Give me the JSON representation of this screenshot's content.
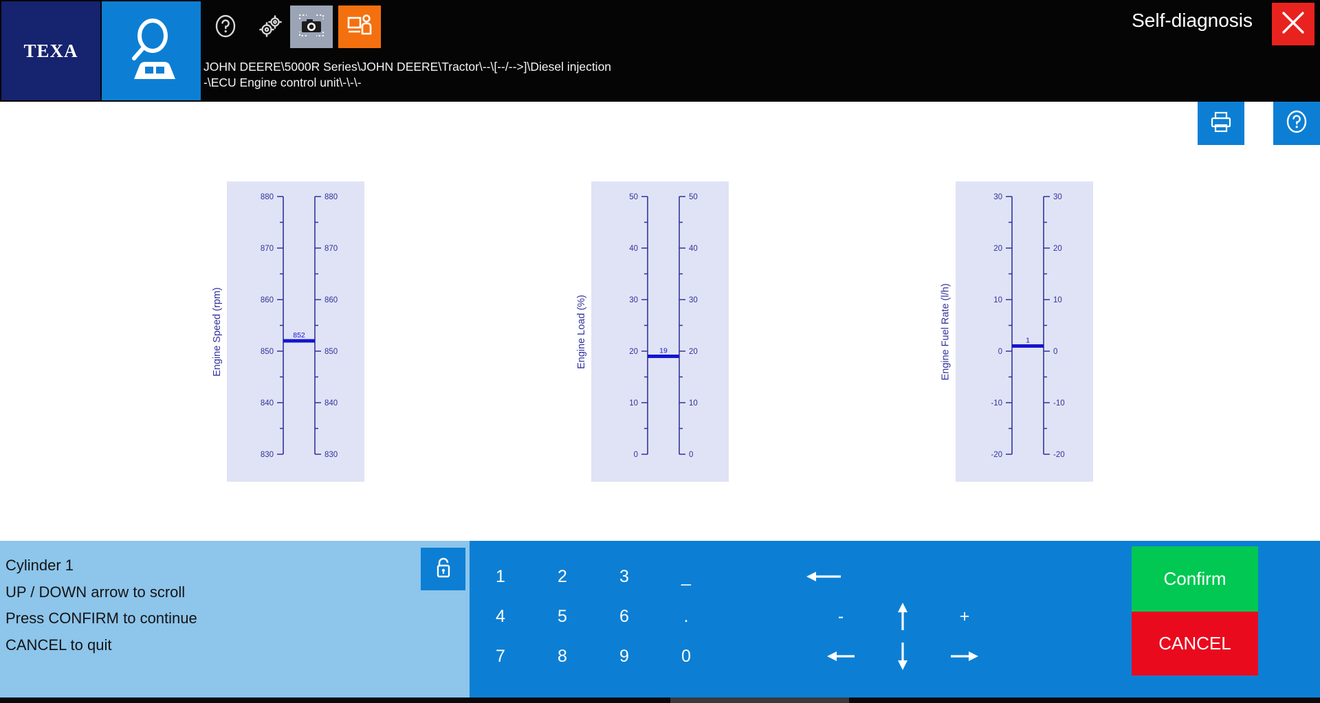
{
  "app": {
    "brand": "TEXA",
    "title": "Self-diagnosis",
    "breadcrumb": "JOHN DEERE\\5000R Series\\JOHN DEERE\\Tractor\\--\\[--/-->]\\Diesel injection\n-\\ECU Engine control unit\\-\\-\\-"
  },
  "toolbar": {
    "help_icon": "question-circle-icon",
    "settings_icon": "gears-icon",
    "screenshot_icon": "camera-icon",
    "report_icon": "report-person-icon",
    "close_icon": "close-x-icon",
    "vehicle_icon": "vehicle-search-icon"
  },
  "subbar": {
    "print_icon": "printer-icon",
    "help_icon": "question-circle-icon"
  },
  "chart_data": [
    {
      "type": "bar",
      "title": "",
      "ylabel": "Engine Speed (rpm)",
      "categories": [
        "Engine Speed"
      ],
      "values": [
        852
      ],
      "value_label": "852",
      "ylim": [
        830,
        880
      ],
      "major_ticks": [
        880,
        870,
        860,
        850,
        840,
        830
      ],
      "minor_tick_step": 5,
      "grid": false,
      "legend": "none",
      "dual_axis": true
    },
    {
      "type": "bar",
      "title": "",
      "ylabel": "Engine Load (%)",
      "categories": [
        "Engine Load"
      ],
      "values": [
        19
      ],
      "value_label": "19",
      "ylim": [
        0,
        50
      ],
      "major_ticks": [
        50,
        40,
        30,
        20,
        10,
        0
      ],
      "minor_tick_step": 5,
      "grid": false,
      "legend": "none",
      "dual_axis": true
    },
    {
      "type": "bar",
      "title": "",
      "ylabel": "Engine Fuel Rate (l/h)",
      "categories": [
        "Engine Fuel Rate"
      ],
      "values": [
        1
      ],
      "value_label": "1",
      "ylim": [
        -20,
        30
      ],
      "major_ticks": [
        30,
        20,
        10,
        0,
        -10,
        -20
      ],
      "minor_tick_step": 5,
      "grid": false,
      "legend": "none",
      "dual_axis": true
    }
  ],
  "bottom": {
    "message": "Cylinder 1\nUP / DOWN arrow to scroll\nPress CONFIRM to continue\nCANCEL to quit",
    "lock_icon": "unlock-icon",
    "keys": [
      {
        "label": "1",
        "name": "key-1"
      },
      {
        "label": "2",
        "name": "key-2"
      },
      {
        "label": "3",
        "name": "key-3"
      },
      {
        "label": "_",
        "name": "key-underscore"
      },
      {
        "label": "4",
        "name": "key-4"
      },
      {
        "label": "5",
        "name": "key-5"
      },
      {
        "label": "6",
        "name": "key-6"
      },
      {
        "label": ".",
        "name": "key-period"
      },
      {
        "label": "-",
        "name": "key-minus"
      },
      {
        "label": "7",
        "name": "key-7"
      },
      {
        "label": "8",
        "name": "key-8"
      },
      {
        "label": "9",
        "name": "key-9"
      },
      {
        "label": "0",
        "name": "key-0"
      }
    ],
    "arrow_keys": {
      "backspace": "backspace-arrow-icon",
      "up": "arrow-up-icon",
      "down": "arrow-down-icon",
      "left": "arrow-left-icon",
      "right": "arrow-right-icon",
      "plus": "+"
    },
    "confirm_label": "Confirm",
    "cancel_label": "CANCEL"
  },
  "colors": {
    "brand_blue": "#0c7fd4",
    "logo_navy": "#16236e",
    "accent_orange": "#f4700f",
    "close_red": "#e8221f",
    "confirm_green": "#00c853",
    "cancel_red": "#ea0a1e",
    "panel_lavender": "#e0e3f5",
    "axis_indigo": "#32329b",
    "value_blue": "#1414d0",
    "msg_panel": "#8dc5eb"
  }
}
